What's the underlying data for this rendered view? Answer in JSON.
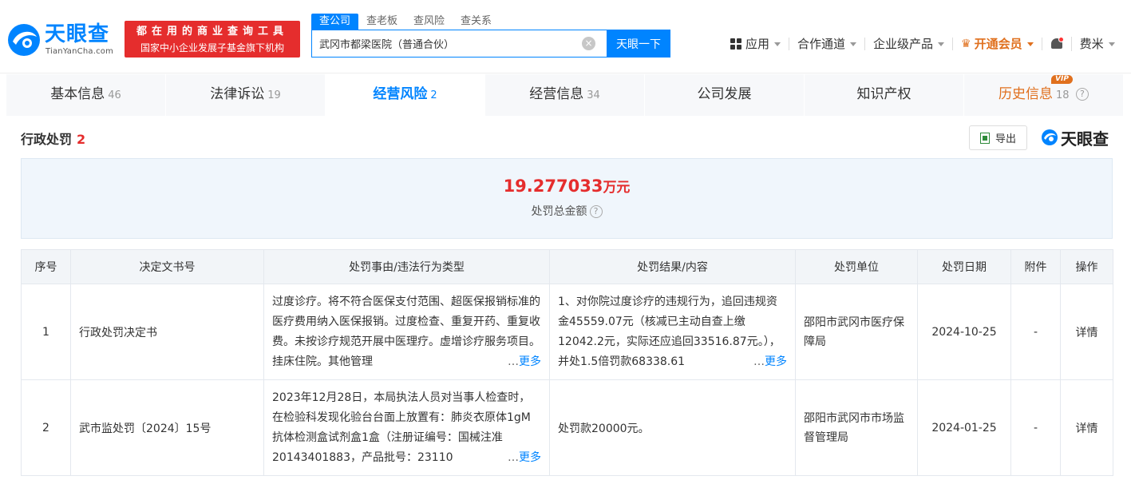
{
  "header": {
    "logo_name": "天眼查",
    "logo_domain": "TianYanCha.com",
    "slogan_line1": "都在用的商业查询工具",
    "slogan_line2": "国家中小企业发展子基金旗下机构",
    "search_tabs": [
      "查公司",
      "查老板",
      "查风险",
      "查关系"
    ],
    "search_value": "武冈市都梁医院（普通合伙）",
    "search_button": "天眼一下",
    "nav": {
      "apps": "应用",
      "channel": "合作通道",
      "enterprise": "企业级产品",
      "vip": "开通会员",
      "user": "费米"
    }
  },
  "tabs": [
    {
      "label": "基本信息",
      "count": "46"
    },
    {
      "label": "法律诉讼",
      "count": "19"
    },
    {
      "label": "经营风险",
      "count": "2"
    },
    {
      "label": "经营信息",
      "count": "34"
    },
    {
      "label": "公司发展",
      "count": ""
    },
    {
      "label": "知识产权",
      "count": ""
    },
    {
      "label": "历史信息",
      "count": "18",
      "badge": "VIP"
    }
  ],
  "section": {
    "title": "行政处罚",
    "count": "2",
    "export_label": "导出",
    "brand": "天眼查"
  },
  "summary": {
    "amount": "19.277033",
    "unit": "万元",
    "label": "处罚总金额"
  },
  "table": {
    "headers": [
      "序号",
      "决定文书号",
      "处罚事由/违法行为类型",
      "处罚结果/内容",
      "处罚单位",
      "处罚日期",
      "附件",
      "操作"
    ],
    "more_label": "更多",
    "rows": [
      {
        "no": "1",
        "doc": "行政处罚决定书",
        "reason": "过度诊疗。将不符合医保支付范围、超医保报销标准的医疗费用纳入医保报销。过度检查、重复开药、重复收费。未按诊疗规范开展中医理疗。虚增诊疗服务项目。挂床住院。其他管理",
        "result": "1、对你院过度诊疗的违规行为，追回违规资金45559.07元（核减已主动自查上缴12042.2元，实际还应追回33516.87元。），并处1.5倍罚款68338.61",
        "org": "邵阳市武冈市医疗保障局",
        "date": "2024-10-25",
        "attach": "-",
        "action": "详情"
      },
      {
        "no": "2",
        "doc": "武市监处罚〔2024〕15号",
        "reason": "2023年12月28日，本局执法人员对当事人检查时，在检验科发现化验台台面上放置有：肺炎衣原体1gM抗体检测盒试剂盒1盒（注册证编号：国械注准20143401883，产品批号：23110",
        "result": "处罚款20000元。",
        "org": "邵阳市武冈市市场监督管理局",
        "date": "2024-01-25",
        "attach": "-",
        "action": "详情"
      }
    ]
  }
}
